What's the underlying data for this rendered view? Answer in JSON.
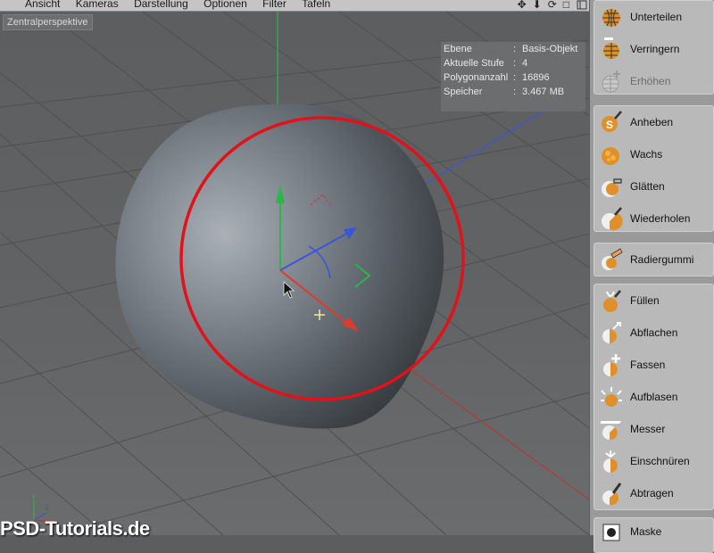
{
  "menubar": {
    "items": [
      "Ansicht",
      "Kameras",
      "Darstellung",
      "Optionen",
      "Filter",
      "Tafeln"
    ],
    "nav_icons": [
      "move-icon",
      "zoom-icon",
      "rotate-icon",
      "maximize-icon"
    ]
  },
  "viewport": {
    "label": "Zentralperspektive",
    "info": [
      {
        "key": "Ebene",
        "value": "Basis-Objekt"
      },
      {
        "key": "Aktuelle Stufe",
        "value": "4"
      },
      {
        "key": "Polygonanzahl",
        "value": "16896"
      },
      {
        "key": "Speicher",
        "value": "3.467 MB"
      }
    ],
    "axis_labels": {
      "y": "Y",
      "z": "Z",
      "x": "X"
    },
    "colors": {
      "brush_circle": "#e0121a",
      "x_axis": "#e03a2a",
      "y_axis": "#28b848",
      "z_axis": "#3a56d8"
    }
  },
  "watermark": "PSD-Tutorials.de",
  "tools": {
    "subdivision": [
      {
        "label": "Unterteilen",
        "icon": "subdivide-icon",
        "enabled": true
      },
      {
        "label": "Verringern",
        "icon": "reduce-icon",
        "enabled": true
      },
      {
        "label": "Erhöhen",
        "icon": "increase-icon",
        "enabled": false
      }
    ],
    "brushes": [
      {
        "label": "Anheben",
        "icon": "pull-brush-icon",
        "enabled": true
      },
      {
        "label": "Wachs",
        "icon": "wax-brush-icon",
        "enabled": true
      },
      {
        "label": "Glätten",
        "icon": "smooth-brush-icon",
        "enabled": true
      },
      {
        "label": "Wiederholen",
        "icon": "repeat-brush-icon",
        "enabled": true
      }
    ],
    "eraser": [
      {
        "label": "Radiergummi",
        "icon": "eraser-brush-icon",
        "enabled": true
      }
    ],
    "shape": [
      {
        "label": "Füllen",
        "icon": "fill-brush-icon",
        "enabled": true
      },
      {
        "label": "Abflachen",
        "icon": "flatten-brush-icon",
        "enabled": true
      },
      {
        "label": "Fassen",
        "icon": "grab-brush-icon",
        "enabled": true
      },
      {
        "label": "Aufblasen",
        "icon": "inflate-brush-icon",
        "enabled": true
      },
      {
        "label": "Messer",
        "icon": "knife-brush-icon",
        "enabled": true
      },
      {
        "label": "Einschnüren",
        "icon": "pinch-brush-icon",
        "enabled": true
      },
      {
        "label": "Abtragen",
        "icon": "scrape-brush-icon",
        "enabled": true
      }
    ],
    "mask": [
      {
        "label": "Maske",
        "icon": "mask-brush-icon",
        "enabled": true
      }
    ]
  }
}
